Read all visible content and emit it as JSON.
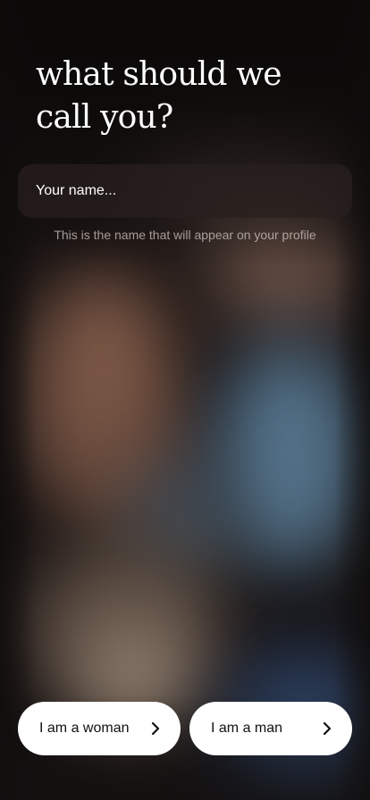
{
  "heading": "what should we call you?",
  "name_input": {
    "placeholder": "Your name...",
    "value": ""
  },
  "helper_text": "This is the name that will appear on your profile",
  "buttons": {
    "woman_label": "I am a woman",
    "man_label": "I am a man"
  },
  "icons": {
    "woman_button_icon": "chevron-right-icon",
    "man_button_icon": "chevron-right-icon"
  },
  "colors": {
    "background": "#141010",
    "text": "#ffffff",
    "button_bg": "#ffffff",
    "button_text": "#111111",
    "input_bg": "#28201e"
  }
}
